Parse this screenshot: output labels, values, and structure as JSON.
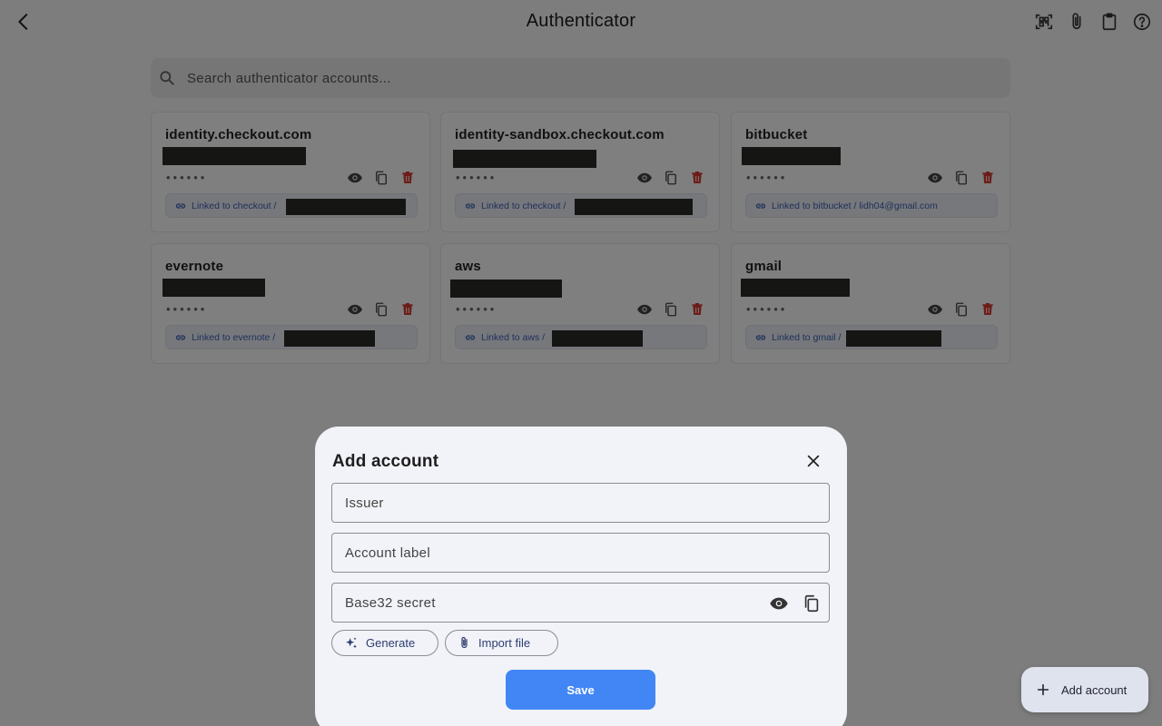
{
  "app": {
    "title": "Authenticator"
  },
  "search": {
    "placeholder": "Search authenticator accounts..."
  },
  "accounts": [
    {
      "issuer": "identity.checkout.com",
      "code_mask": "••••••",
      "linked_text": "Linked to checkout /"
    },
    {
      "issuer": "identity-sandbox.checkout.com",
      "code_mask": "••••••",
      "linked_text": "Linked to checkout /"
    },
    {
      "issuer": "bitbucket",
      "code_mask": "••••••",
      "linked_text": "Linked to bitbucket / lidh04@gmail.com"
    },
    {
      "issuer": "evernote",
      "code_mask": "••••••",
      "linked_text": "Linked to evernote /"
    },
    {
      "issuer": "aws",
      "code_mask": "••••••",
      "linked_text": "Linked to aws /"
    },
    {
      "issuer": "gmail",
      "code_mask": "••••••",
      "linked_text": "Linked to gmail /"
    }
  ],
  "fab": {
    "label": "Add account"
  },
  "dialog": {
    "title": "Add account",
    "issuer_label": "Issuer",
    "account_label": "Account label",
    "secret_label": "Base32 secret",
    "generate_label": "Generate",
    "import_label": "Import file",
    "save_label": "Save"
  },
  "colors": {
    "accent": "#4286f5",
    "delete": "#d93a2e",
    "link": "#3d62b3"
  },
  "icons": {
    "back": "chevron-left-icon",
    "qr": "qr-scan-icon",
    "attach": "paperclip-icon",
    "clipboard": "clipboard-icon",
    "help": "help-icon"
  }
}
